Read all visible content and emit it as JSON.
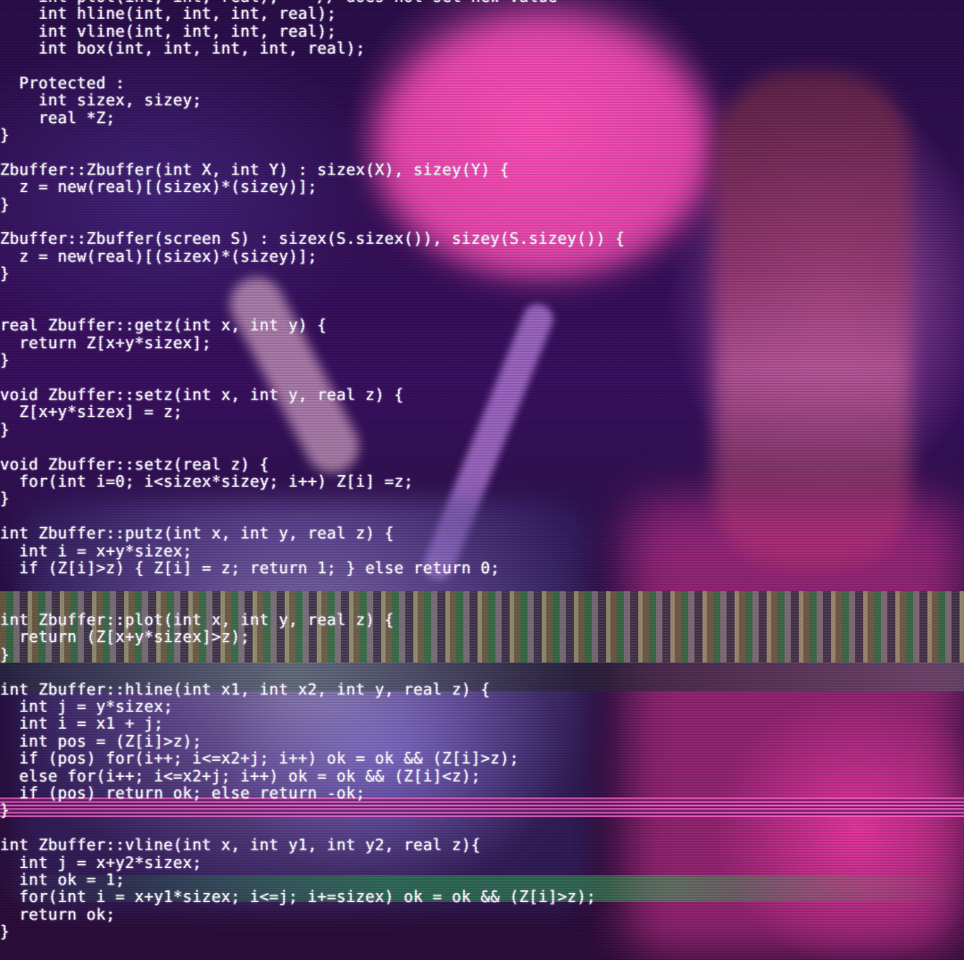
{
  "code_lines": [
    "    int plot(int, int, real);    // does not set new value",
    "    int hline(int, int, int, real);",
    "    int vline(int, int, int, real);",
    "    int box(int, int, int, int, real);",
    "",
    "  Protected :",
    "    int sizex, sizey;",
    "    real *Z;",
    "}",
    "",
    "Zbuffer::Zbuffer(int X, int Y) : sizex(X), sizey(Y) {",
    "  z = new(real)[(sizex)*(sizey)];",
    "}",
    "",
    "Zbuffer::Zbuffer(screen S) : sizex(S.sizex()), sizey(S.sizey()) {",
    "  z = new(real)[(sizex)*(sizey)];",
    "}",
    "",
    "",
    "real Zbuffer::getz(int x, int y) {",
    "  return Z[x+y*sizex];",
    "}",
    "",
    "void Zbuffer::setz(int x, int y, real z) {",
    "  Z[x+y*sizex] = z;",
    "}",
    "",
    "void Zbuffer::setz(real z) {",
    "  for(int i=0; i<sizex*sizey; i++) Z[i] =z;",
    "}",
    "",
    "int Zbuffer::putz(int x, int y, real z) {",
    "  int i = x+y*sizex;",
    "  if (Z[i]>z) { Z[i] = z; return 1; } else return 0;",
    "",
    "",
    "int Zbuffer::plot(int x, int y, real z) {",
    "  return (Z[x+y*sizex]>z);",
    "}",
    "",
    "int Zbuffer::hline(int x1, int x2, int y, real z) {",
    "  int j = y*sizex;",
    "  int i = x1 + j;",
    "  int pos = (Z[i]>z);",
    "  if (pos) for(i++; i<=x2+j; i++) ok = ok && (Z[i]>z);",
    "  else for(i++; i<=x2+j; i++) ok = ok && (Z[i]<z);",
    "  if (pos) return ok; else return -ok;",
    "}",
    "",
    "int Zbuffer::vline(int x, int y1, int y2, real z){",
    "  int j = x+y2*sizex;",
    "  int ok = 1;",
    "  for(int i = x+y1*sizex; i<=j; i+=sizex) ok = ok && (Z[i]>z);",
    "  return ok;",
    "}"
  ]
}
